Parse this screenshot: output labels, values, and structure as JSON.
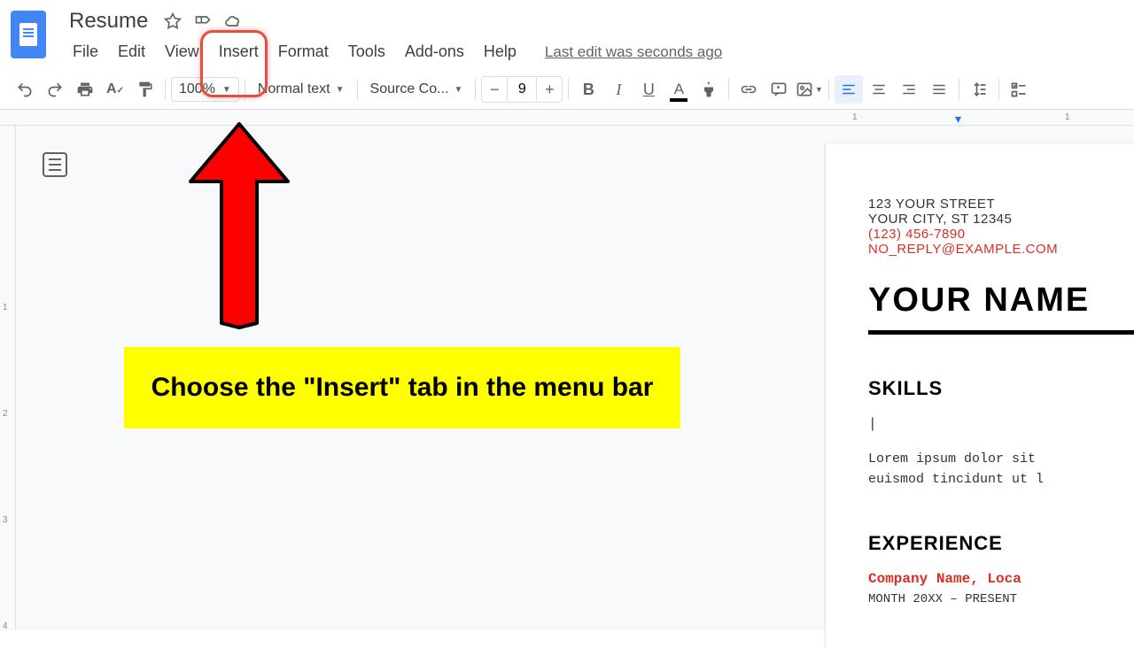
{
  "doc": {
    "title": "Resume",
    "last_edit": "Last edit was seconds ago"
  },
  "menu": {
    "file": "File",
    "edit": "Edit",
    "view": "View",
    "insert": "Insert",
    "format": "Format",
    "tools": "Tools",
    "addons": "Add-ons",
    "help": "Help"
  },
  "toolbar": {
    "zoom": "100%",
    "style": "Normal text",
    "font": "Source Co...",
    "font_size": "9"
  },
  "ruler": {
    "tick1": "1",
    "tick2": "1"
  },
  "vruler": {
    "n1": "1",
    "n2": "2",
    "n3": "3",
    "n4": "4"
  },
  "resume": {
    "street": "123 YOUR STREET",
    "city": "YOUR CITY, ST 12345",
    "phone": "(123) 456-7890",
    "email": "NO_REPLY@EXAMPLE.COM",
    "name": "YOUR NAME",
    "skills_h": "SKILLS",
    "cursor": "|",
    "lorem1": "Lorem ipsum dolor sit",
    "lorem2": "euismod tincidunt ut l",
    "exp_h": "EXPERIENCE",
    "company": "Company Name, Loca",
    "dates": "MONTH 20XX – PRESENT"
  },
  "annotation": {
    "text": "Choose the \"Insert\" tab in the menu bar"
  }
}
